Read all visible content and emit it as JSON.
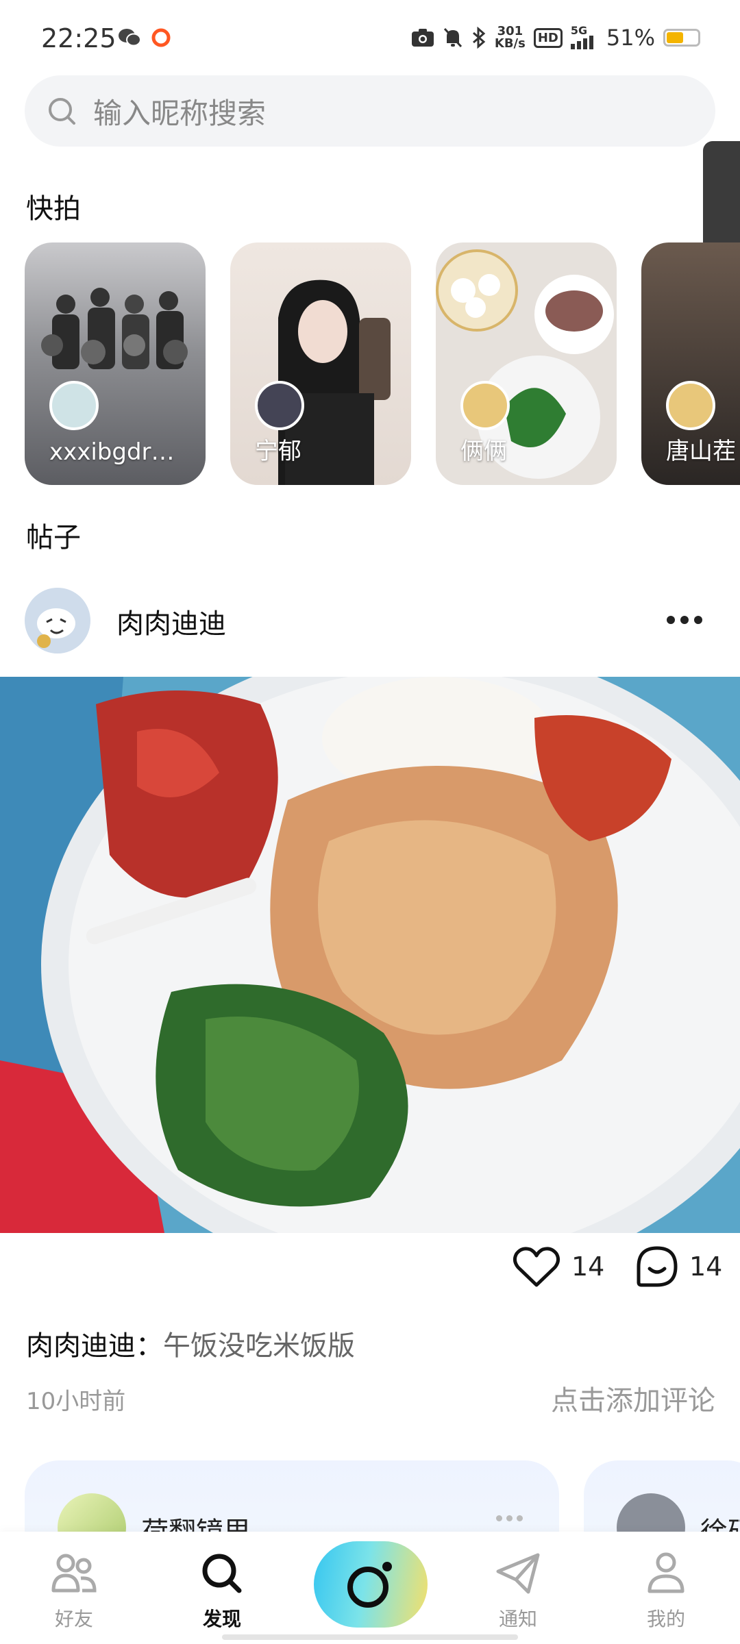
{
  "status_bar": {
    "time": "22:25",
    "net_speed_value": "301",
    "net_speed_unit": "KB/s",
    "hd_label": "HD",
    "signal_label": "5G",
    "battery_percent": "51%",
    "battery_level": 0.51,
    "icons": [
      "wechat-icon",
      "record-icon",
      "camera-icon",
      "mute-icon",
      "bluetooth-icon",
      "signal-icon",
      "battery-icon"
    ]
  },
  "search": {
    "placeholder": "输入昵称搜索"
  },
  "snapshots": {
    "title": "快拍",
    "items": [
      {
        "name": "xxxibgdr…"
      },
      {
        "name": "宁郁"
      },
      {
        "name": "俩俩"
      },
      {
        "name": "唐山茬"
      }
    ]
  },
  "posts_section": {
    "title": "帖子"
  },
  "post": {
    "author": "肉肉迪迪",
    "likes": "14",
    "comments": "14",
    "caption_author": "肉肉迪迪：",
    "caption_text": "午饭没吃米饭版",
    "time": "10小时前",
    "add_comment": "点击添加评论"
  },
  "recommendations": [
    {
      "name": "荷翻镜里"
    },
    {
      "name": "徐硕"
    }
  ],
  "nav": {
    "friends": "好友",
    "discover": "发现",
    "notify": "通知",
    "mine": "我的"
  },
  "colors": {
    "accent_gradient_start": "#36c6f0",
    "accent_gradient_end": "#f4e06a",
    "battery": "#f4b400"
  }
}
